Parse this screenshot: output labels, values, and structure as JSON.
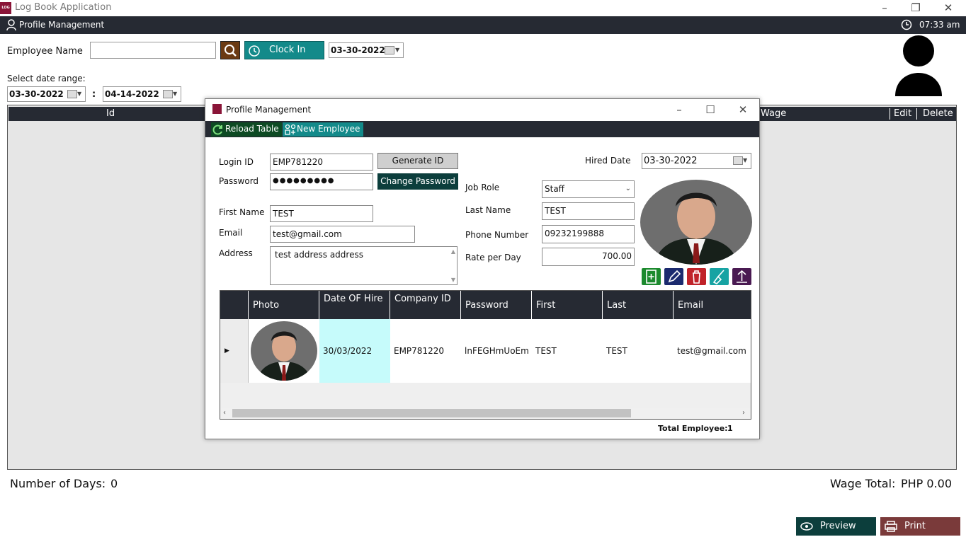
{
  "app": {
    "title": "Log Book Application",
    "logo_text": "LOG"
  },
  "menubar": {
    "label": "Profile Management",
    "time": "07:33 am"
  },
  "top": {
    "employee_name_label": "Employee Name",
    "employee_name_value": "",
    "clock_in_label": "Clock In",
    "clock_date": "03-30-2022",
    "date_range_label": "Select date range:",
    "range_from": "03-30-2022",
    "range_sep": ":",
    "range_to": "04-14-2022"
  },
  "main_grid": {
    "columns": {
      "id": "Id",
      "wage": "Wage",
      "edit": "Edit",
      "delete": "Delete"
    }
  },
  "footer": {
    "days_label": "Number of Days:",
    "days_value": "0",
    "wage_label": "Wage Total:",
    "wage_value": "PHP 0.00",
    "preview_label": "Preview",
    "print_label": "Print"
  },
  "dialog": {
    "title": "Profile Management",
    "toolbar": {
      "reload": "Reload Table",
      "new": "New Employee"
    },
    "form": {
      "login_id_label": "Login ID",
      "login_id": "EMP781220",
      "generate_id": "Generate ID",
      "password_label": "Password",
      "password": "●●●●●●●●●",
      "change_password": "Change Password",
      "first_name_label": "First Name",
      "first_name": "TEST",
      "email_label": "Email",
      "email": "test@gmail.com",
      "address_label": "Address",
      "address": "test address address",
      "hired_date_label": "Hired Date",
      "hired_date": "03-30-2022",
      "job_role_label": "Job Role",
      "job_role": "Staff",
      "last_name_label": "Last Name",
      "last_name": "TEST",
      "phone_label": "Phone Number",
      "phone": "09232199888",
      "rate_label": "Rate per Day",
      "rate": "700.00"
    },
    "table": {
      "headers": [
        "Photo",
        "Date OF Hire",
        "Company ID",
        "Password",
        "First",
        "Last",
        "Email"
      ],
      "rows": [
        {
          "date": "30/03/2022",
          "company_id": "EMP781220",
          "password": "lnFEGHmUoEm",
          "first": "TEST",
          "last": "TEST",
          "email": "test@gmail.com"
        }
      ]
    },
    "total_label": "Total Employee:",
    "total_value": "1"
  },
  "colors": {
    "dark": "#262a33",
    "teal": "#138a8a",
    "darkteal": "#0c4a45",
    "brown": "#6b3a12",
    "red": "#7a3a3a"
  }
}
